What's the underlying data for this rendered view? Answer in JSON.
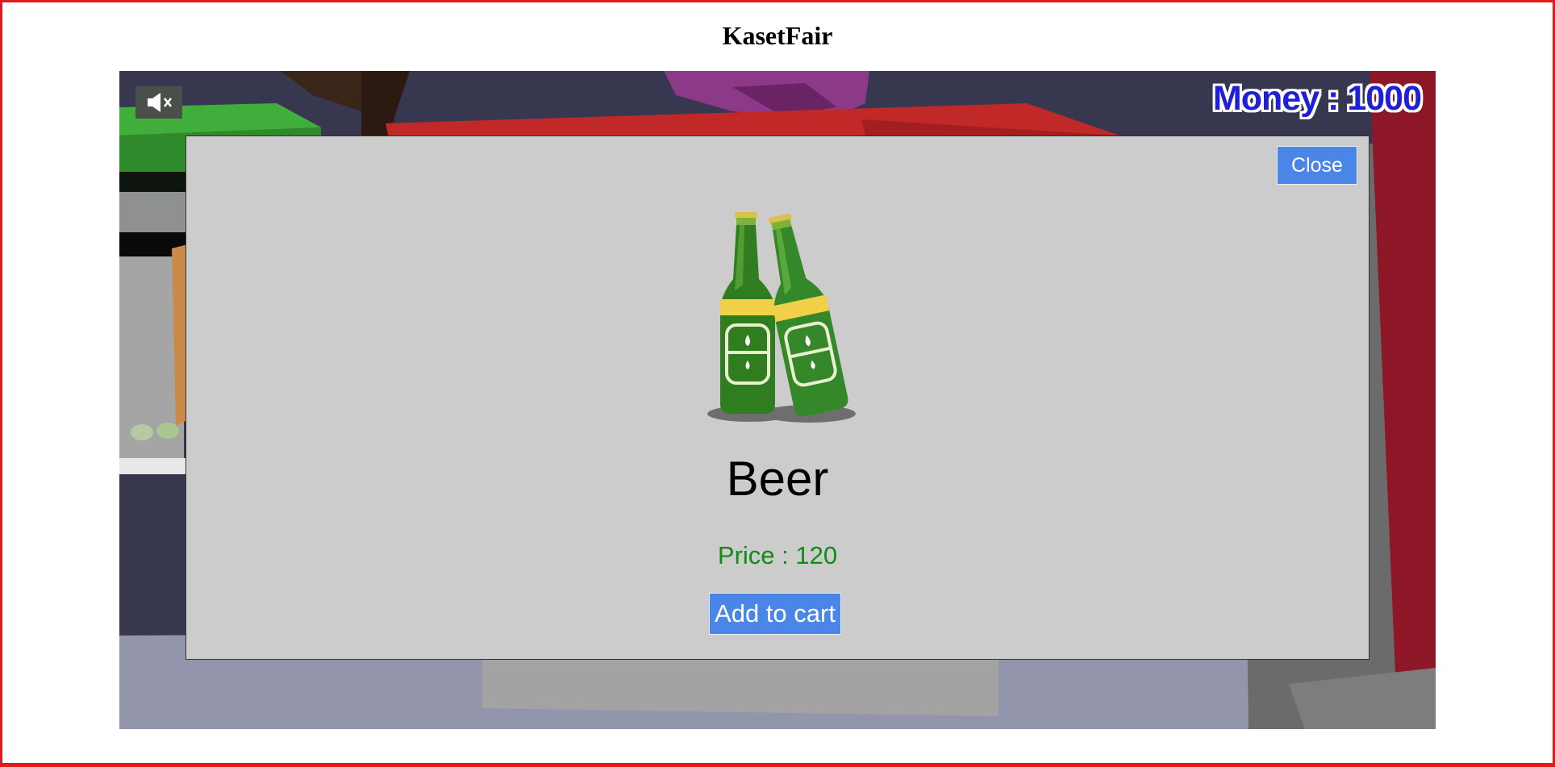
{
  "page": {
    "title": "KasetFair"
  },
  "hud": {
    "mute_icon": "speaker-muted-icon",
    "money_label": "Money",
    "money_separator": " : ",
    "money_value": "1000"
  },
  "modal": {
    "close_label": "Close",
    "product": {
      "image_icon": "beer-bottles-icon",
      "name": "Beer",
      "price_label": "Price : ",
      "price_value": "120",
      "add_to_cart_label": "Add to cart"
    }
  },
  "colors": {
    "frame_border": "#e11b1b",
    "button_blue": "#4a86e8",
    "price_green": "#138a13",
    "money_blue": "#1f1fd6",
    "modal_bg": "#cccccc"
  }
}
